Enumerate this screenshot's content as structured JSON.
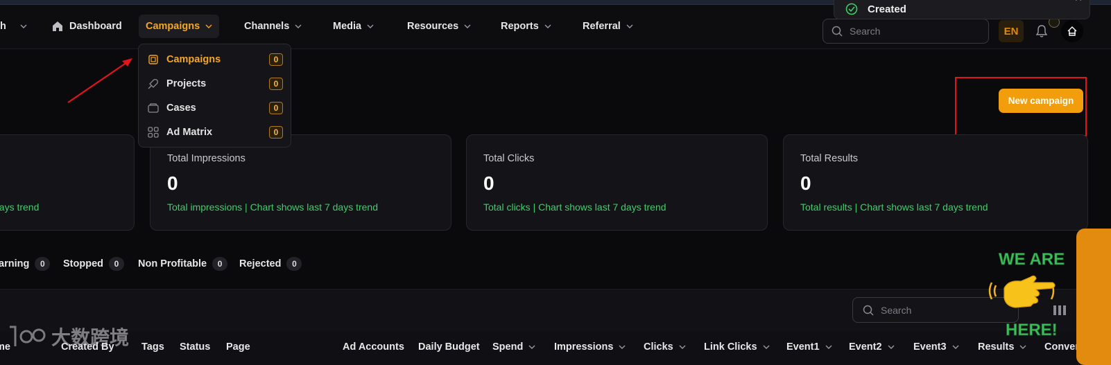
{
  "nav": {
    "partial_label": "h",
    "items": [
      {
        "label": "Dashboard"
      },
      {
        "label": "Campaigns"
      },
      {
        "label": "Channels"
      },
      {
        "label": "Media"
      },
      {
        "label": "Resources"
      },
      {
        "label": "Reports"
      },
      {
        "label": "Referral"
      }
    ],
    "search_placeholder": "Search",
    "language": "EN"
  },
  "toast": {
    "message": "Created"
  },
  "dropdown": {
    "items": [
      {
        "label": "Campaigns",
        "count": "0",
        "icon": "chip-icon"
      },
      {
        "label": "Projects",
        "count": "0",
        "icon": "rocket-icon"
      },
      {
        "label": "Cases",
        "count": "0",
        "icon": "folder-icon"
      },
      {
        "label": "Ad Matrix",
        "count": "0",
        "icon": "grid-icon"
      }
    ]
  },
  "actions": {
    "new_campaign": "New campaign"
  },
  "cards": [
    {
      "title": "",
      "value": "",
      "subtitle": "days trend"
    },
    {
      "title": "Total Impressions",
      "value": "0",
      "subtitle": "Total impressions | Chart shows last 7 days trend"
    },
    {
      "title": "Total Clicks",
      "value": "0",
      "subtitle": "Total clicks | Chart shows last 7 days trend"
    },
    {
      "title": "Total Results",
      "value": "0",
      "subtitle": "Total results | Chart shows last 7 days trend"
    }
  ],
  "status_tabs": [
    {
      "label": "arning",
      "count": "0"
    },
    {
      "label": "Stopped",
      "count": "0"
    },
    {
      "label": "Non Profitable",
      "count": "0"
    },
    {
      "label": "Rejected",
      "count": "0"
    }
  ],
  "table": {
    "search_placeholder": "Search",
    "columns": [
      "me",
      "Created By",
      "Tags",
      "Status",
      "Page",
      "Ad Accounts",
      "Daily Budget",
      "Spend",
      "Impressions",
      "Clicks",
      "Link Clicks",
      "Event1",
      "Event2",
      "Event3",
      "Results",
      "Conver"
    ]
  },
  "promo": {
    "line1": "WE ARE",
    "line2": "HERE!"
  },
  "watermark": {
    "text": "大数跨境"
  },
  "colors": {
    "accent": "#f5a623",
    "green": "#3fcf6a",
    "annotation_red": "#e0141c",
    "button": "#f29d0c"
  }
}
